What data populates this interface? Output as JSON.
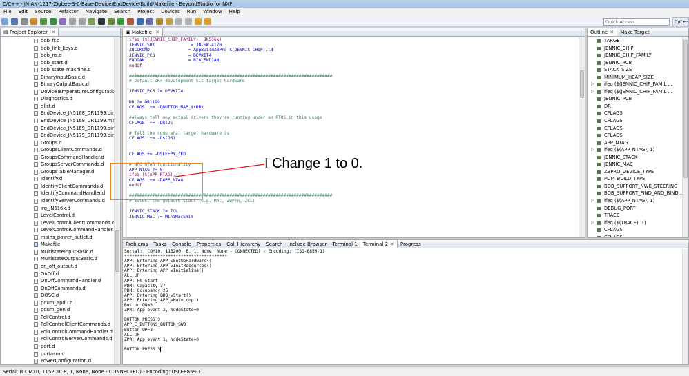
{
  "window": {
    "title": "C/C++ - JN-AN-1217-Zigbee-3-0-Base-Device/EndDevice/Build/Makefile - BeyondStudio for NXP",
    "controls": [
      "–",
      "□",
      "✕"
    ]
  },
  "menu": [
    "File",
    "Edit",
    "Source",
    "Refactor",
    "Navigate",
    "Search",
    "Project",
    "Devices",
    "Run",
    "Window",
    "Help"
  ],
  "toolbar": {
    "quick_access_placeholder": "Quick Access",
    "perspective": "C/C++"
  },
  "explorer": {
    "tab": "Project Explorer",
    "files": [
      "bdb_fr.d",
      "bdb_link_keys.d",
      "bdb_ns.d",
      "bdb_start.d",
      "bdb_state_machine.d",
      "BinaryInputBasic.d",
      "BinaryOutputBasic.d",
      "DeviceTemperatureConfiguration.d",
      "Diagnostics.d",
      "dlist.d",
      "EndDevice_JN5168_DR1199.bin",
      "EndDevice_JN5168_DR1199.map",
      "EndDevice_JN5169_DR1199.bin",
      "EndDevice_JN5179_DR1199.bin",
      "Groups.d",
      "GroupsClientCommands.d",
      "GroupsCommandHandler.d",
      "GroupsServerCommands.d",
      "GroupsTableManager.d",
      "Identify.d",
      "IdentifyClientCommands.d",
      "IdentifyCommandHandler.d",
      "IdentifyServerCommands.d",
      "irq_JN516x.d",
      "LevelControl.d",
      "LevelControlClientCommands.d",
      "LevelControlCommandHandler.d",
      "mains_power_outlet.d",
      "Makefile",
      "MultistateInputBasic.d",
      "MultistateOutputBasic.d",
      "on_off_output.d",
      "OnOff.d",
      "OnOffCommandHandler.d",
      "OnOffCommands.d",
      "OOSC.d",
      "pdum_apdu.d",
      "pdum_gen.d",
      "PollControl.d",
      "PollControlClientCommands.d",
      "PollControlCommandHandler.d",
      "PollControlServerCommands.d",
      "port.d",
      "portasm.d",
      "PowerConfiguration.d"
    ]
  },
  "editor": {
    "tab": "Makefile",
    "lines": [
      {
        "t": "ifeq ($(JENNIC_CHIP_FAMILY), JN516x)",
        "c": "kw"
      },
      {
        "t": "JENNIC_SDK              = JN-SW-4170",
        "c": "var"
      },
      {
        "t": "ZNCLKCMD               = AppBuildZBPro_$(JENNIC_CHIP).ld",
        "c": "var"
      },
      {
        "t": "JENNIC_PCB             = DEVKIT4",
        "c": "var"
      },
      {
        "t": "ENDIAN                 = BIG_ENDIAN",
        "c": "var"
      },
      {
        "t": "endif",
        "c": "kw"
      },
      {
        "t": "",
        "c": ""
      },
      {
        "t": "###############################################################################",
        "c": "cm"
      },
      {
        "t": "# Default DK4 development kit target hardware",
        "c": "cm"
      },
      {
        "t": "",
        "c": ""
      },
      {
        "t": "JENNIC_PCB ?= DEVKIT4",
        "c": "var"
      },
      {
        "t": "",
        "c": ""
      },
      {
        "t": "DR ?= DR1199",
        "c": "var"
      },
      {
        "t": "CFLAGS  += -DBUTTON_MAP_$(DR)",
        "c": "var"
      },
      {
        "t": "",
        "c": ""
      },
      {
        "t": "#Always tell any actual drivers they're running under an RTOS in this usage",
        "c": "cm"
      },
      {
        "t": "CFLAGS  += -DRTOS",
        "c": "var"
      },
      {
        "t": "",
        "c": ""
      },
      {
        "t": "# Tell the code what target hardware is",
        "c": "cm"
      },
      {
        "t": "CFLAGS  += -D$(DR)",
        "c": "var"
      },
      {
        "t": "",
        "c": ""
      },
      {
        "t": "",
        "c": ""
      },
      {
        "t": "CFLAGS += -DSLEEPY_ZED",
        "c": "var"
      },
      {
        "t": "",
        "c": ""
      },
      {
        "t": "# NFC NTAG functionality",
        "c": "cm"
      },
      {
        "t": "APP_NTAG ?= 0",
        "c": "var"
      },
      {
        "t": "ifeq ($(APP_NTAG), 1)",
        "c": "kw"
      },
      {
        "t": "CFLAGS  += -DAPP_NTAG",
        "c": "var"
      },
      {
        "t": "endif",
        "c": "kw"
      },
      {
        "t": "",
        "c": ""
      },
      {
        "t": "###############################################################################",
        "c": "cm"
      },
      {
        "t": "# Select the network stack (e.g. MAC, ZBPro, ZCL)",
        "c": "cm"
      },
      {
        "t": "",
        "c": ""
      },
      {
        "t": "JENNIC_STACK ?= ZCL",
        "c": "var"
      },
      {
        "t": "JENNIC_MAC ?= MiniMacShim",
        "c": "var"
      },
      {
        "t": "",
        "c": ""
      },
      {
        "t": "",
        "c": ""
      },
      {
        "t": "",
        "c": ""
      }
    ]
  },
  "outline": {
    "tabs": [
      "Outline",
      "Make Target"
    ],
    "items": [
      {
        "label": "TARGET",
        "exp": false
      },
      {
        "label": "JENNIC_CHIP",
        "exp": false
      },
      {
        "label": "JENNIC_CHIP_FAMILY",
        "exp": false
      },
      {
        "label": "JENNIC_PCB",
        "exp": false
      },
      {
        "label": "STACK_SIZE",
        "exp": false
      },
      {
        "label": "MINIMUM_HEAP_SIZE",
        "exp": false
      },
      {
        "label": "ifeq ($(JENNIC_CHIP_FAMIL ...",
        "exp": true
      },
      {
        "label": "ifeq ($(JENNIC_CHIP_FAMIL ...",
        "exp": true
      },
      {
        "label": "JENNIC_PCB",
        "exp": false
      },
      {
        "label": "DR",
        "exp": false
      },
      {
        "label": "CFLAGS",
        "exp": false
      },
      {
        "label": "CFLAGS",
        "exp": false
      },
      {
        "label": "CFLAGS",
        "exp": false
      },
      {
        "label": "CFLAGS",
        "exp": false
      },
      {
        "label": "APP_NTAG",
        "exp": false
      },
      {
        "label": "ifeq ($(APP_NTAG), 1)",
        "exp": true
      },
      {
        "label": "JENNIC_STACK",
        "exp": false
      },
      {
        "label": "JENNIC_MAC",
        "exp": false
      },
      {
        "label": "ZBPRO_DEVICE_TYPE",
        "exp": false
      },
      {
        "label": "PDM_BUILD_TYPE",
        "exp": false
      },
      {
        "label": "BDB_SUPPORT_NWK_STEERING",
        "exp": false
      },
      {
        "label": "BDB_SUPPORT_FIND_AND_BIND ...",
        "exp": false
      },
      {
        "label": "ifeq ($(APP_NTAG), 1)",
        "exp": true
      },
      {
        "label": "DEBUG_PORT",
        "exp": false
      },
      {
        "label": "TRACE",
        "exp": false
      },
      {
        "label": "ifeq ($(TRACE), 1)",
        "exp": true
      },
      {
        "label": "CFLAGS",
        "exp": false
      },
      {
        "label": "CFLAGS",
        "exp": false
      }
    ]
  },
  "bottom": {
    "tabs": [
      "Problems",
      "Tasks",
      "Console",
      "Properties",
      "Call Hierarchy",
      "Search",
      "Include Browser",
      "Terminal 1",
      "Terminal 2",
      "Progress"
    ],
    "active_tab": "Terminal 2",
    "lines": [
      "Serial: (COM10, 115200, 8, 1, None, None - CONNECTED) - Encoding: (ISO-8859-1)",
      "****************************************",
      "APP: Entering APP_vSetUpHardware()",
      "APP: Entering APP_vInitResources()",
      "APP: Entering APP_vInitialise()",
      "ALL UP",
      "APP: FN Start",
      "PDM: Capacity 37",
      "PDM: Occupancy 26",
      "APP: Entering BDB_vStart()",
      "APP: Entering APP_vMainLoop()",
      "Button DN=3",
      "ZPR: App event 2, NodeState=0",
      "",
      "BUTTON PRESS 3",
      "APP_E_BUTTONS_BUTTON_SW3",
      "Button UP=3",
      "ALL UP",
      "ZPR: App event 1, NodeState=0",
      "",
      "BUTTON PRESS 3"
    ]
  },
  "status": "Serial: (COM10, 115200, 8, 1, None, None - CONNECTED) - Encoding: (ISO-8859-1)",
  "annotation": {
    "text": "I Change 1 to 0.",
    "color": "#f08a24"
  }
}
